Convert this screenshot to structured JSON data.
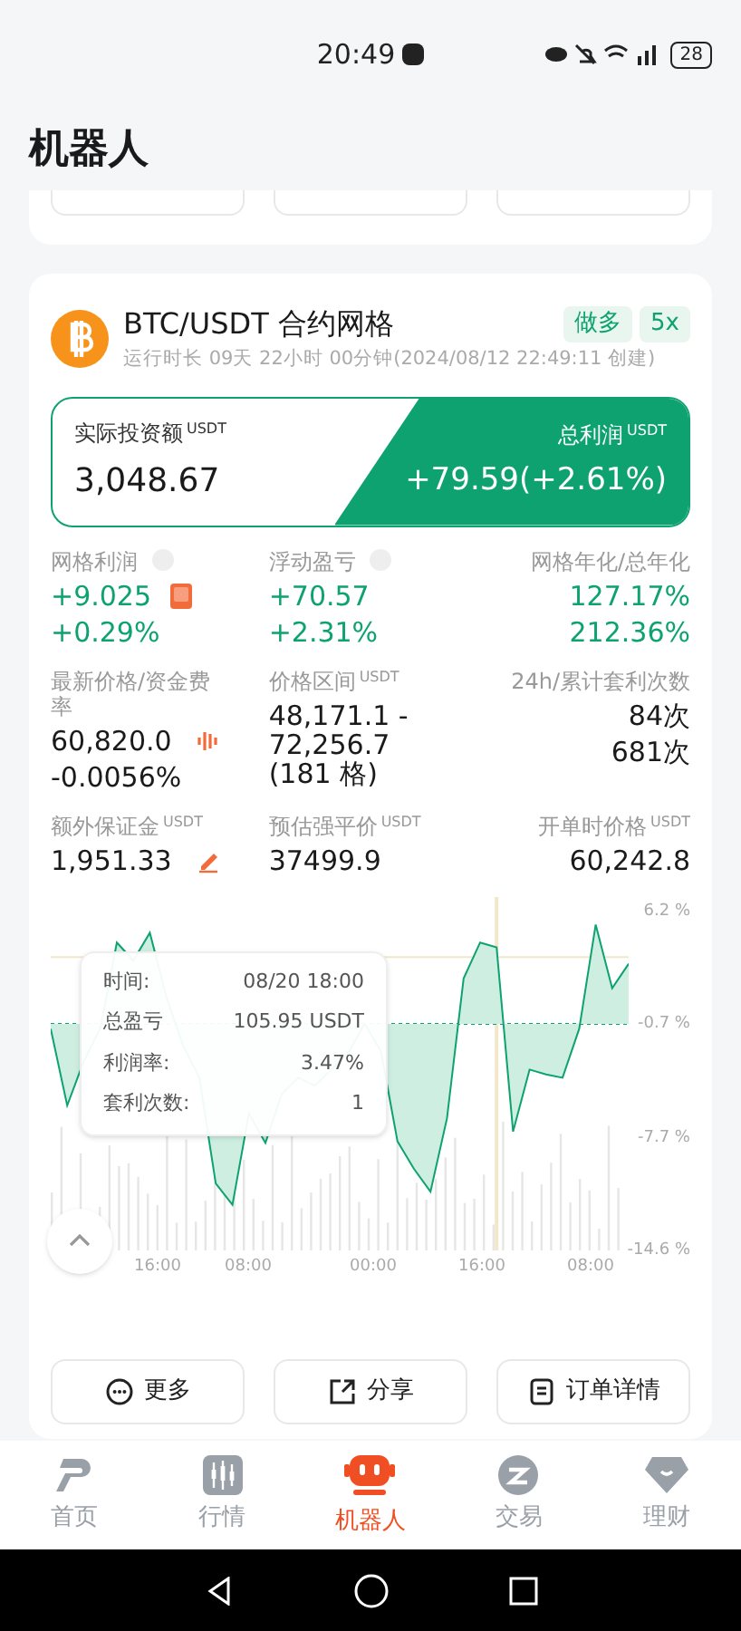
{
  "status_bar": {
    "time": "20:49",
    "battery": "28"
  },
  "header": {
    "title": "机器人"
  },
  "bot": {
    "pair": "BTC/USDT 合约网格",
    "runtime": "运行时长 09天 22小时 00分钟(2024/08/12 22:49:11 创建)",
    "tags": [
      {
        "label": "做多"
      },
      {
        "label": "5x"
      }
    ],
    "investment": {
      "label": "实际投资额",
      "unit": "USDT",
      "value": "3,048.67"
    },
    "profit": {
      "label": "总利润",
      "unit": "USDT",
      "value": "+79.59(+2.61%)"
    },
    "stats": [
      {
        "label": "网格利润",
        "info": true,
        "lines": [
          "+9.025",
          "+0.29%"
        ]
      },
      {
        "label": "浮动盈亏",
        "info": true,
        "lines": [
          "+70.57",
          "+2.31%"
        ]
      },
      {
        "label": "网格年化/总年化",
        "info": false,
        "lines": [
          "127.17%",
          "212.36%"
        ]
      },
      {
        "label": "最新价格/资金费率",
        "info": false,
        "lines": [
          "60,820.0",
          "-0.0056%"
        ]
      },
      {
        "label": "价格区间",
        "unit": "USDT",
        "info": false,
        "lines": [
          "48,171.1 - 72,256.7 (181 格)"
        ]
      },
      {
        "label": "24h/累计套利次数",
        "info": false,
        "lines": [
          "84次",
          "681次"
        ]
      },
      {
        "label": "额外保证金",
        "unit": "USDT",
        "info": false,
        "lines": [
          "1,951.33"
        ]
      },
      {
        "label": "预估强平价",
        "unit": "USDT",
        "info": false,
        "lines": [
          "37499.9"
        ]
      },
      {
        "label": "开单时价格",
        "unit": "USDT",
        "info": false,
        "lines": [
          "60,242.8"
        ]
      }
    ],
    "chart": {
      "y_labels": [
        "6.2 %",
        "-0.7 %",
        "-7.7 %",
        "-14.6 %"
      ],
      "x_labels": [
        "16:00",
        "08:00",
        "00:00",
        "16:00",
        "08:00"
      ]
    },
    "tooltip": [
      {
        "label": "时间:",
        "value": "08/20 18:00"
      },
      {
        "label": "总盈亏",
        "value": "105.95 USDT"
      },
      {
        "label": "利润率:",
        "value": "3.47%"
      },
      {
        "label": "套利次数:",
        "value": "1"
      }
    ],
    "actions": [
      {
        "label": "更多"
      },
      {
        "label": "分享"
      },
      {
        "label": "订单详情"
      }
    ]
  },
  "tab_bar": [
    {
      "label": "首页",
      "selected": false
    },
    {
      "label": "行情",
      "selected": false
    },
    {
      "label": "机器人",
      "selected": true
    },
    {
      "label": "交易",
      "selected": false
    },
    {
      "label": "理财",
      "selected": false
    }
  ]
}
